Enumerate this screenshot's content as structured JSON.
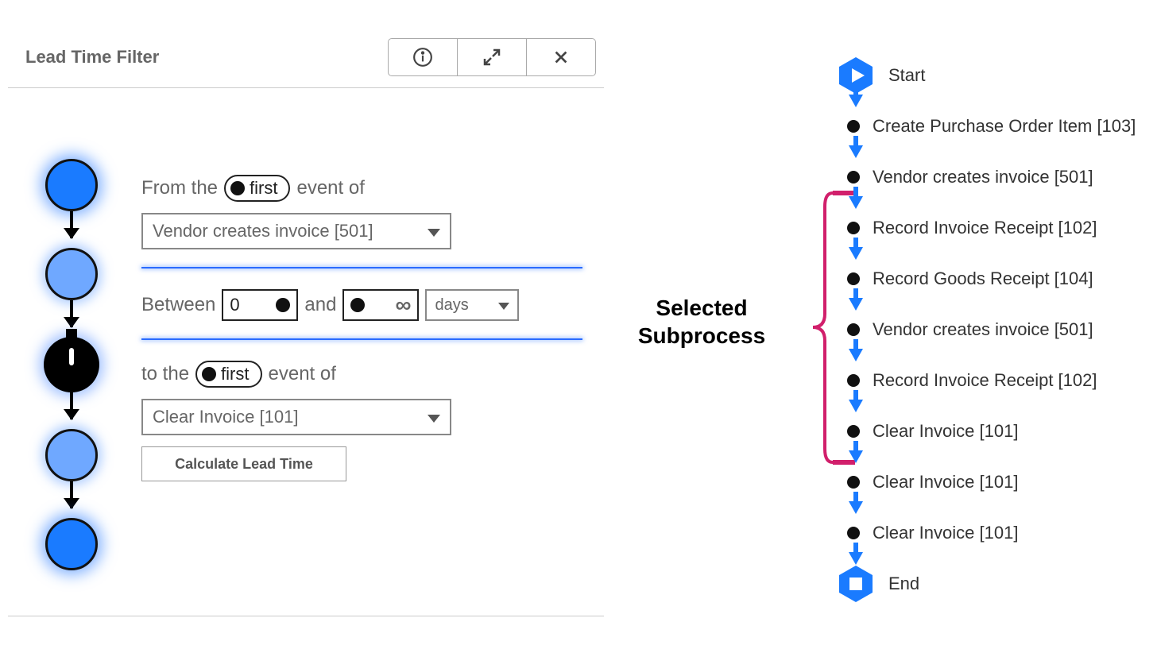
{
  "panel": {
    "title": "Lead Time Filter",
    "from_label_prefix": "From the",
    "from_label_suffix": "event of",
    "from_toggle": "first",
    "from_select": "Vendor creates invoice [501]",
    "between_label": "Between",
    "between_and": "and",
    "between_min": "0",
    "between_max": "∞",
    "unit": "days",
    "to_label_prefix": "to the",
    "to_label_suffix": "event of",
    "to_toggle": "first",
    "to_select": "Clear Invoice [101]",
    "calc_button": "Calculate Lead Time"
  },
  "annotation": {
    "line1": "Selected",
    "line2": "Subprocess"
  },
  "flow": {
    "start": "Start",
    "end": "End",
    "steps": [
      "Create Purchase Order Item [103]",
      "Vendor creates invoice [501]",
      "Record Invoice Receipt [102]",
      "Record Goods Receipt [104]",
      "Vendor creates invoice [501]",
      "Record Invoice Receipt [102]",
      "Clear Invoice [101]",
      "Clear Invoice [101]",
      "Clear Invoice [101]"
    ]
  }
}
